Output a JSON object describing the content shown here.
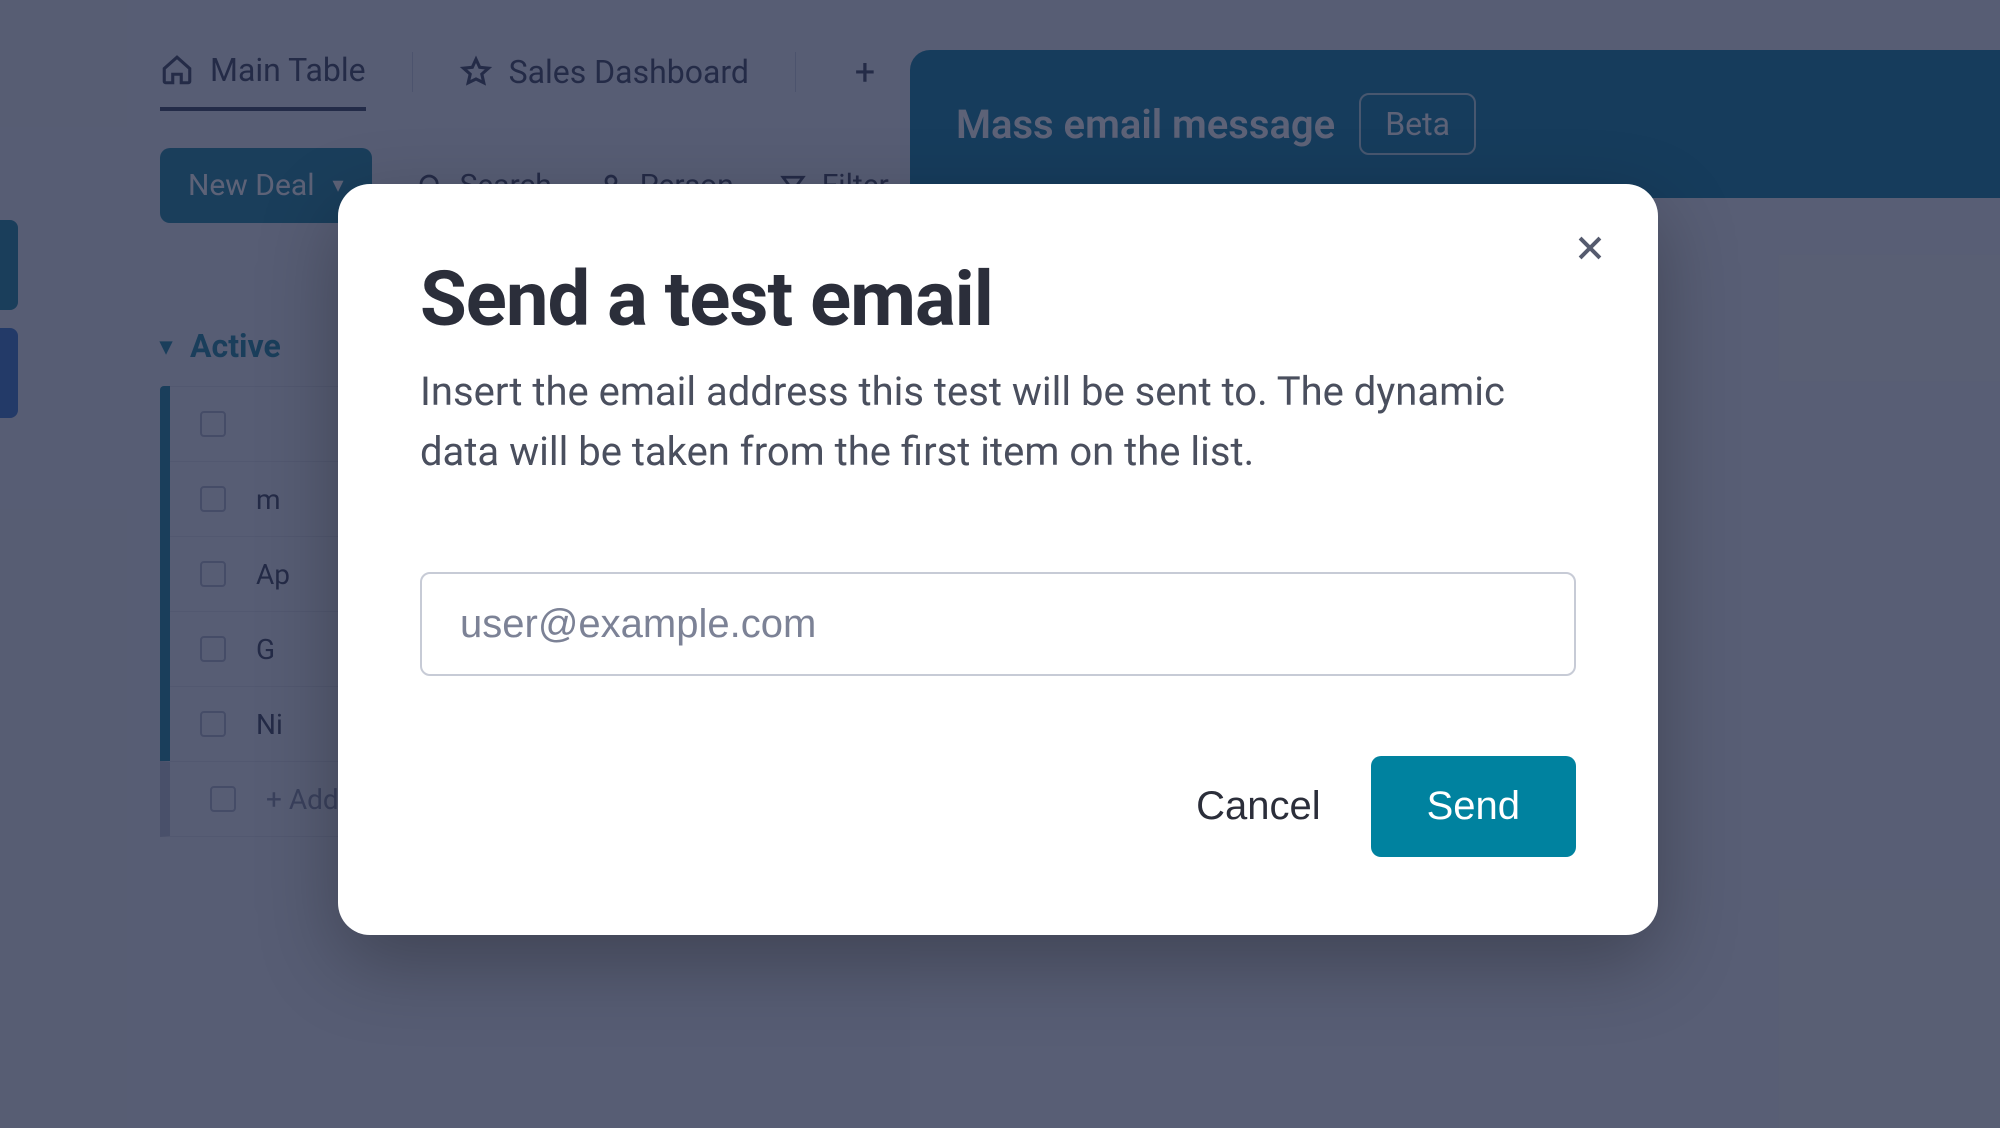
{
  "background": {
    "tabs": {
      "main": {
        "label": "Main Table"
      },
      "sales": {
        "label": "Sales Dashboard"
      },
      "add": {
        "label": "+"
      }
    },
    "toolbar": {
      "new_deal_label": "New Deal",
      "search_label": "Search",
      "person_label": "Person",
      "filter_label": "Filter"
    },
    "group": {
      "title": "Active"
    },
    "rows": [
      {
        "text": ""
      },
      {
        "text": "m"
      },
      {
        "text": "Ap"
      },
      {
        "text": "G"
      },
      {
        "text": "Ni"
      },
      {
        "text": "+ Add"
      }
    ]
  },
  "mass_panel": {
    "title": "Mass email message",
    "badge": "Beta"
  },
  "modal": {
    "title": "Send a test email",
    "description": "Insert the email address this test will be sent to. The dynamic data will be taken from the first item on the list.",
    "email_placeholder": "user@example.com",
    "email_value": "",
    "cancel_label": "Cancel",
    "send_label": "Send"
  }
}
